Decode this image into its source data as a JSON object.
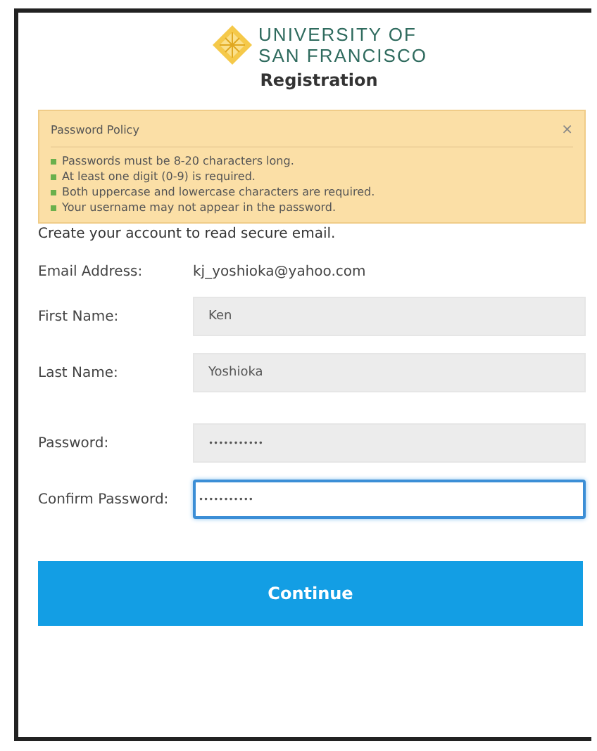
{
  "logo": {
    "line_1": "UNIVERSITY OF",
    "line_2": "SAN FRANCISCO"
  },
  "title": "Registration",
  "policy": {
    "heading": "Password Policy",
    "close": "×",
    "items": [
      "Passwords must be 8-20 characters long.",
      "At least one digit (0-9) is required.",
      "Both uppercase and lowercase characters are required.",
      "Your username may not appear in the password."
    ]
  },
  "intro": "Create your account to read secure email.",
  "fields": [
    {
      "label": "Email Address:",
      "kind": "static",
      "value": "kj_yoshioka@yahoo.com"
    },
    {
      "label": "First Name:",
      "kind": "input",
      "value": "Ken",
      "focused": false
    },
    {
      "label": "Last Name:",
      "kind": "input",
      "value": "Yoshioka",
      "focused": false
    },
    {
      "label": "Password:",
      "kind": "password",
      "value": "•••••••••••",
      "focused": false
    },
    {
      "label": "Confirm Password:",
      "kind": "password",
      "value": "•••••••••••",
      "focused": true
    }
  ],
  "button": "Continue"
}
